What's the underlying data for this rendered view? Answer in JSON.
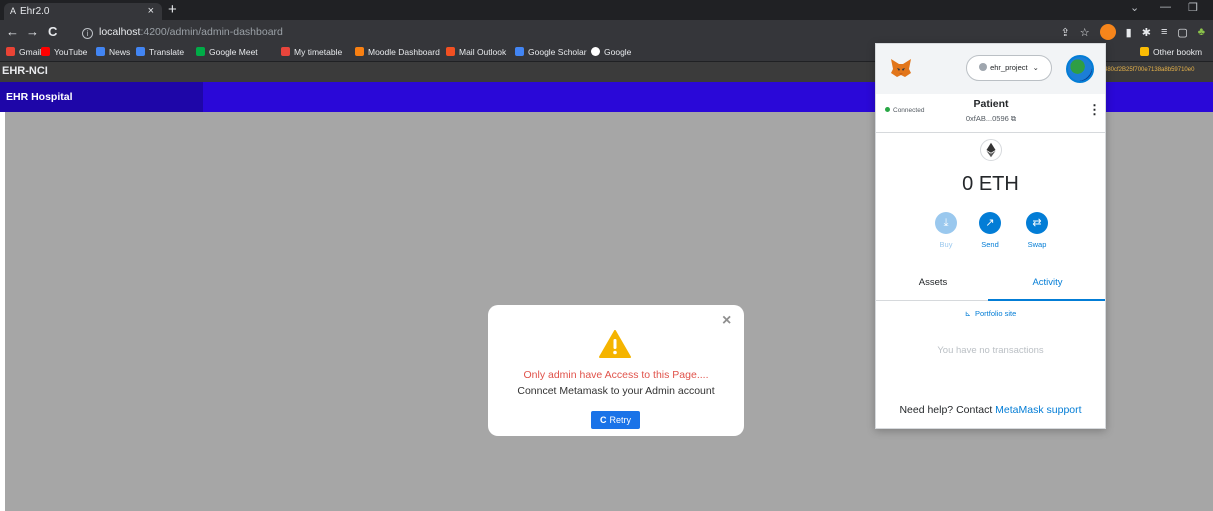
{
  "browser": {
    "tab_title": "Ehr2.0",
    "tab_close": "×",
    "new_tab": "+",
    "url_host": "localhost",
    "url_path": ":4200/admin/admin-dashboard",
    "bookmarks": [
      "Gmail",
      "YouTube",
      "News",
      "Translate",
      "Google Meet",
      "My timetable",
      "Moodle Dashboard",
      "Mail Outlook",
      "Google Scholar",
      "Google"
    ],
    "other_bookmarks": "Other bookm"
  },
  "app": {
    "brand": "EHR-NCI",
    "hospital_title": "EHR Hospital",
    "address_tail": "480cf2B25f700e7138a8b59710e0"
  },
  "modal": {
    "close": "×",
    "error_text": "Only admin have Access to this Page....",
    "info_text": "Conncet Metamask to your Admin account",
    "retry_label": "Retry"
  },
  "metamask": {
    "network": "ehr_project",
    "connection_status": "Connected",
    "account_name": "Patient",
    "account_address": "0xfAB...0596",
    "balance": "0 ETH",
    "actions": [
      {
        "label": "Buy",
        "enabled": false
      },
      {
        "label": "Send",
        "enabled": true
      },
      {
        "label": "Swap",
        "enabled": true
      }
    ],
    "tabs": [
      "Assets",
      "Activity"
    ],
    "active_tab": "Activity",
    "portfolio_link": "Portfolio site",
    "empty_state": "You have no transactions",
    "help_prefix": "Need help? Contact ",
    "help_link": "MetaMask support"
  },
  "colors": {
    "hospital_bar": "#2a08d8",
    "metamask_blue": "#037dd6",
    "error_red": "#e0524a",
    "warning_yellow": "#f5b400"
  }
}
